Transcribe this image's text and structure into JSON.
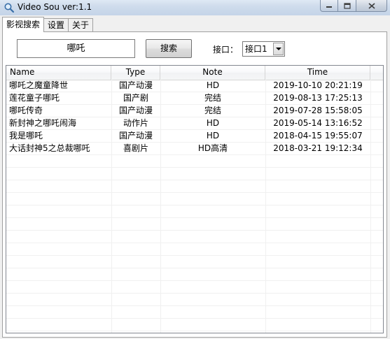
{
  "window": {
    "title": "Video Sou  ver:1.1"
  },
  "tabs": [
    {
      "label": "影视搜索",
      "active": true
    },
    {
      "label": "设置",
      "active": false
    },
    {
      "label": "关于",
      "active": false
    }
  ],
  "search": {
    "value": "哪吒",
    "button_label": "搜索",
    "interface_label": "接口：",
    "interface_selected": "接口1"
  },
  "table": {
    "columns": [
      "Name",
      "Type",
      "Note",
      "Time"
    ],
    "rows": [
      {
        "name": "哪吒之魔童降世",
        "type": "国产动漫",
        "note": "HD",
        "time": "2019-10-10 20:21:19"
      },
      {
        "name": "莲花童子哪吒",
        "type": "国产剧",
        "note": "完结",
        "time": "2019-08-13 17:25:13"
      },
      {
        "name": "哪吒传奇",
        "type": "国产动漫",
        "note": "完结",
        "time": "2019-07-28 15:58:05"
      },
      {
        "name": "新封神之哪吒闹海",
        "type": "动作片",
        "note": "HD",
        "time": "2019-05-14 13:16:52"
      },
      {
        "name": "我是哪吒",
        "type": "国产动漫",
        "note": "HD",
        "time": "2018-04-15 19:55:07"
      },
      {
        "name": "大话封神5之总裁哪吒",
        "type": "喜剧片",
        "note": "HD高清",
        "time": "2018-03-21 19:12:34"
      }
    ]
  }
}
